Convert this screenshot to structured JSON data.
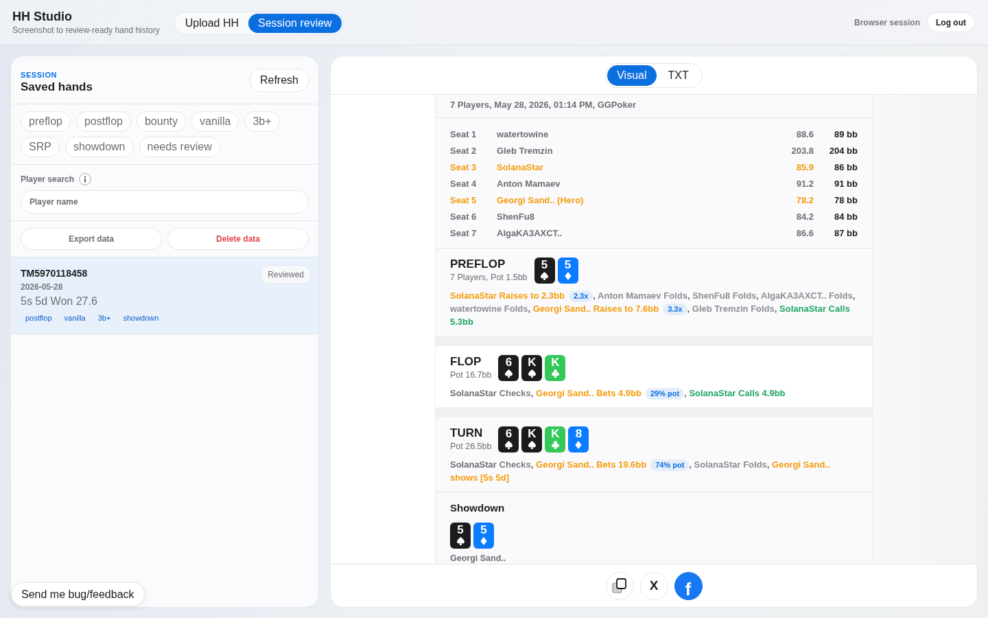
{
  "app": {
    "title": "HH Studio",
    "subtitle": "Screenshot to review-ready hand history"
  },
  "nav_tabs": [
    {
      "label": "Upload HH",
      "selected": false
    },
    {
      "label": "Session review",
      "selected": true
    }
  ],
  "account": {
    "session_label": "Browser session",
    "logout": "Log out"
  },
  "sidebar": {
    "eyebrow": "SESSION",
    "title": "Saved hands",
    "refresh": "Refresh",
    "filters": [
      {
        "label": "preflop",
        "selected": false
      },
      {
        "label": "postflop",
        "selected": false
      },
      {
        "label": "bounty",
        "selected": false
      },
      {
        "label": "vanilla",
        "selected": false
      },
      {
        "label": "3b+",
        "selected": false
      },
      {
        "label": "SRP",
        "selected": false
      },
      {
        "label": "showdown",
        "selected": false
      },
      {
        "label": "needs review",
        "selected": false
      }
    ],
    "player_search": {
      "label": "Player search",
      "placeholder": "Player name"
    },
    "data_buttons": [
      {
        "label": "Export data",
        "kind": "neutral"
      },
      {
        "label": "Delete data",
        "kind": "danger"
      }
    ],
    "hands": [
      {
        "id": "TM5970118458",
        "date": "2026-05-28",
        "summary": "5s 5d Won 27.6",
        "status": "Reviewed",
        "tags": [
          "postflop",
          "vanilla",
          "3b+",
          "showdown"
        ],
        "selected": true
      }
    ]
  },
  "feedback_button": "Send me bug/feedback",
  "viewer": {
    "view_tabs": [
      {
        "label": "Visual",
        "selected": true
      },
      {
        "label": "TXT",
        "selected": false
      }
    ],
    "hand": {
      "meta": "7 Players, May 28, 2026, 01:14 PM, GGPoker",
      "seats": [
        {
          "seat": "Seat 1",
          "name": "watertowine",
          "stack": "88.6",
          "bb": "89 bb",
          "highlighted": false
        },
        {
          "seat": "Seat 2",
          "name": "Gleb Tremzin",
          "stack": "203.8",
          "bb": "204 bb",
          "highlighted": false
        },
        {
          "seat": "Seat 3",
          "name": "SolanaStar",
          "stack": "85.9",
          "bb": "86 bb",
          "highlighted": true
        },
        {
          "seat": "Seat 4",
          "name": "Anton Mamaev",
          "stack": "91.2",
          "bb": "91 bb",
          "highlighted": false
        },
        {
          "seat": "Seat 5",
          "name": "Georgi Sand.. (Hero)",
          "stack": "78.2",
          "bb": "78 bb",
          "highlighted": true
        },
        {
          "seat": "Seat 6",
          "name": "ShenFu8",
          "stack": "84.2",
          "bb": "84 bb",
          "highlighted": false
        },
        {
          "seat": "Seat 7",
          "name": "AlgaKA3AXCT..",
          "stack": "86.6",
          "bb": "87 bb",
          "highlighted": false
        }
      ],
      "streets": [
        {
          "name": "PREFLOP",
          "info": "7 Players, Pot 1.5bb",
          "cards": [
            {
              "rank": "5",
              "kind": "spade"
            },
            {
              "rank": "5",
              "kind": "diamond"
            }
          ],
          "actions": [
            {
              "player": "SolanaStar",
              "verb": "Raises to 2.3bb",
              "kind": "aggressive",
              "badge": "2.3x",
              "punct": ","
            },
            {
              "player": "Anton Mamaev",
              "verb": "Folds",
              "kind": "fold",
              "punct": ","
            },
            {
              "player": "ShenFu8",
              "verb": "Folds",
              "kind": "fold",
              "punct": ","
            },
            {
              "player": "AlgaKA3AXCT..",
              "verb": "Folds",
              "kind": "fold",
              "punct": ","
            },
            {
              "player": "watertowine",
              "verb": "Folds",
              "kind": "fold",
              "punct": ","
            },
            {
              "player": "Georgi Sand..",
              "verb": "Raises to 7.6bb",
              "kind": "aggressive",
              "badge": "3.3x",
              "punct": ","
            },
            {
              "player": "Gleb Tremzin",
              "verb": "Folds",
              "kind": "fold",
              "punct": ","
            },
            {
              "player": "SolanaStar",
              "verb": "Calls 5.3bb",
              "kind": "call"
            }
          ]
        },
        {
          "name": "FLOP",
          "info": "Pot 16.7bb",
          "cards": [
            {
              "rank": "6",
              "kind": "spade"
            },
            {
              "rank": "K",
              "kind": "spade"
            },
            {
              "rank": "K",
              "kind": "club"
            }
          ],
          "actions": [
            {
              "player": "SolanaStar",
              "verb": "Checks",
              "kind": "check",
              "punct": ","
            },
            {
              "player": "Georgi Sand..",
              "verb": "Bets 4.9bb",
              "kind": "aggressive",
              "badge": "29% pot",
              "punct": ","
            },
            {
              "player": "SolanaStar",
              "verb": "Calls 4.9bb",
              "kind": "call"
            }
          ]
        },
        {
          "name": "TURN",
          "info": "Pot 26.5bb",
          "cards": [
            {
              "rank": "6",
              "kind": "spade"
            },
            {
              "rank": "K",
              "kind": "spade"
            },
            {
              "rank": "K",
              "kind": "club"
            },
            {
              "rank": "8",
              "kind": "diamond"
            }
          ],
          "actions": [
            {
              "player": "SolanaStar",
              "verb": "Checks",
              "kind": "check",
              "punct": ","
            },
            {
              "player": "Georgi Sand..",
              "verb": "Bets 19.6bb",
              "kind": "aggressive",
              "badge": "74% pot",
              "punct": ","
            },
            {
              "player": "SolanaStar",
              "verb": "Folds",
              "kind": "fold",
              "punct": ","
            },
            {
              "player": "Georgi Sand..",
              "verb": "shows [5s 5d]",
              "kind": "aggressive"
            }
          ]
        }
      ],
      "showdown": {
        "title": "Showdown",
        "hands": [
          {
            "cards": [
              {
                "rank": "5",
                "kind": "spade"
              },
              {
                "rank": "5",
                "kind": "diamond"
              }
            ],
            "player": "Georgi Sand.."
          }
        ]
      }
    },
    "share_buttons": [
      {
        "kind": "copy"
      },
      {
        "kind": "x",
        "label": "X"
      },
      {
        "kind": "facebook",
        "label": "f"
      }
    ]
  }
}
